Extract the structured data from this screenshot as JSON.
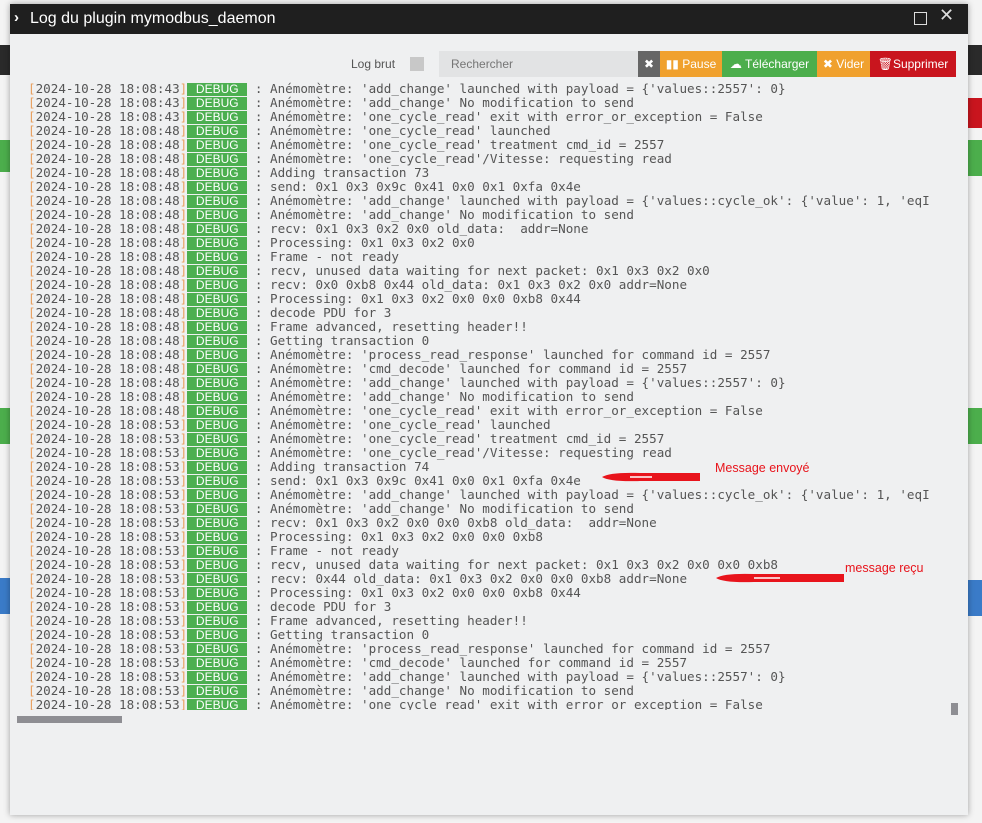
{
  "dialog": {
    "title": "Log du plugin mymodbus_daemon",
    "maximize_icon": "square-icon",
    "close_icon": "close-icon"
  },
  "toolbar": {
    "raw_log_label": "Log brut",
    "search_placeholder": "Rechercher",
    "clear_search": "✖",
    "pause_label": "Pause",
    "download_label": "Télécharger",
    "empty_label": "Vider",
    "delete_label": "Supprimer",
    "colors": {
      "pause": "#f0a12e",
      "download": "#4cae4c",
      "empty": "#f0a12e",
      "delete": "#c9151e",
      "clear": "#666666"
    }
  },
  "log_lines": [
    {
      "ts": "2024-10-28 18:08:43",
      "level": "DEBUG",
      "msg": ": Anémomètre: 'add_change' launched with payload = {'values::2557': 0}"
    },
    {
      "ts": "2024-10-28 18:08:43",
      "level": "DEBUG",
      "msg": ": Anémomètre: 'add_change' No modification to send"
    },
    {
      "ts": "2024-10-28 18:08:43",
      "level": "DEBUG",
      "msg": ": Anémomètre: 'one_cycle_read' exit with error_or_exception = False"
    },
    {
      "ts": "2024-10-28 18:08:48",
      "level": "DEBUG",
      "msg": ": Anémomètre: 'one_cycle_read' launched"
    },
    {
      "ts": "2024-10-28 18:08:48",
      "level": "DEBUG",
      "msg": ": Anémomètre: 'one_cycle_read' treatment cmd_id = 2557"
    },
    {
      "ts": "2024-10-28 18:08:48",
      "level": "DEBUG",
      "msg": ": Anémomètre: 'one_cycle_read'/Vitesse: requesting read"
    },
    {
      "ts": "2024-10-28 18:08:48",
      "level": "DEBUG",
      "msg": ": Adding transaction 73"
    },
    {
      "ts": "2024-10-28 18:08:48",
      "level": "DEBUG",
      "msg": ": send: 0x1 0x3 0x9c 0x41 0x0 0x1 0xfa 0x4e"
    },
    {
      "ts": "2024-10-28 18:08:48",
      "level": "DEBUG",
      "msg": ": Anémomètre: 'add_change' launched with payload = {'values::cycle_ok': {'value': 1, 'eqI"
    },
    {
      "ts": "2024-10-28 18:08:48",
      "level": "DEBUG",
      "msg": ": Anémomètre: 'add_change' No modification to send"
    },
    {
      "ts": "2024-10-28 18:08:48",
      "level": "DEBUG",
      "msg": ": recv: 0x1 0x3 0x2 0x0 old_data:  addr=None"
    },
    {
      "ts": "2024-10-28 18:08:48",
      "level": "DEBUG",
      "msg": ": Processing: 0x1 0x3 0x2 0x0"
    },
    {
      "ts": "2024-10-28 18:08:48",
      "level": "DEBUG",
      "msg": ": Frame - not ready"
    },
    {
      "ts": "2024-10-28 18:08:48",
      "level": "DEBUG",
      "msg": ": recv, unused data waiting for next packet: 0x1 0x3 0x2 0x0"
    },
    {
      "ts": "2024-10-28 18:08:48",
      "level": "DEBUG",
      "msg": ": recv: 0x0 0xb8 0x44 old_data: 0x1 0x3 0x2 0x0 addr=None"
    },
    {
      "ts": "2024-10-28 18:08:48",
      "level": "DEBUG",
      "msg": ": Processing: 0x1 0x3 0x2 0x0 0x0 0xb8 0x44"
    },
    {
      "ts": "2024-10-28 18:08:48",
      "level": "DEBUG",
      "msg": ": decode PDU for 3"
    },
    {
      "ts": "2024-10-28 18:08:48",
      "level": "DEBUG",
      "msg": ": Frame advanced, resetting header!!"
    },
    {
      "ts": "2024-10-28 18:08:48",
      "level": "DEBUG",
      "msg": ": Getting transaction 0"
    },
    {
      "ts": "2024-10-28 18:08:48",
      "level": "DEBUG",
      "msg": ": Anémomètre: 'process_read_response' launched for command id = 2557"
    },
    {
      "ts": "2024-10-28 18:08:48",
      "level": "DEBUG",
      "msg": ": Anémomètre: 'cmd_decode' launched for command id = 2557"
    },
    {
      "ts": "2024-10-28 18:08:48",
      "level": "DEBUG",
      "msg": ": Anémomètre: 'add_change' launched with payload = {'values::2557': 0}"
    },
    {
      "ts": "2024-10-28 18:08:48",
      "level": "DEBUG",
      "msg": ": Anémomètre: 'add_change' No modification to send"
    },
    {
      "ts": "2024-10-28 18:08:48",
      "level": "DEBUG",
      "msg": ": Anémomètre: 'one_cycle_read' exit with error_or_exception = False"
    },
    {
      "ts": "2024-10-28 18:08:53",
      "level": "DEBUG",
      "msg": ": Anémomètre: 'one_cycle_read' launched"
    },
    {
      "ts": "2024-10-28 18:08:53",
      "level": "DEBUG",
      "msg": ": Anémomètre: 'one_cycle_read' treatment cmd_id = 2557"
    },
    {
      "ts": "2024-10-28 18:08:53",
      "level": "DEBUG",
      "msg": ": Anémomètre: 'one_cycle_read'/Vitesse: requesting read"
    },
    {
      "ts": "2024-10-28 18:08:53",
      "level": "DEBUG",
      "msg": ": Adding transaction 74"
    },
    {
      "ts": "2024-10-28 18:08:53",
      "level": "DEBUG",
      "msg": ": send: 0x1 0x3 0x9c 0x41 0x0 0x1 0xfa 0x4e"
    },
    {
      "ts": "2024-10-28 18:08:53",
      "level": "DEBUG",
      "msg": ": Anémomètre: 'add_change' launched with payload = {'values::cycle_ok': {'value': 1, 'eqI"
    },
    {
      "ts": "2024-10-28 18:08:53",
      "level": "DEBUG",
      "msg": ": Anémomètre: 'add_change' No modification to send"
    },
    {
      "ts": "2024-10-28 18:08:53",
      "level": "DEBUG",
      "msg": ": recv: 0x1 0x3 0x2 0x0 0x0 0xb8 old_data:  addr=None"
    },
    {
      "ts": "2024-10-28 18:08:53",
      "level": "DEBUG",
      "msg": ": Processing: 0x1 0x3 0x2 0x0 0x0 0xb8"
    },
    {
      "ts": "2024-10-28 18:08:53",
      "level": "DEBUG",
      "msg": ": Frame - not ready"
    },
    {
      "ts": "2024-10-28 18:08:53",
      "level": "DEBUG",
      "msg": ": recv, unused data waiting for next packet: 0x1 0x3 0x2 0x0 0x0 0xb8"
    },
    {
      "ts": "2024-10-28 18:08:53",
      "level": "DEBUG",
      "msg": ": recv: 0x44 old_data: 0x1 0x3 0x2 0x0 0x0 0xb8 addr=None"
    },
    {
      "ts": "2024-10-28 18:08:53",
      "level": "DEBUG",
      "msg": ": Processing: 0x1 0x3 0x2 0x0 0x0 0xb8 0x44"
    },
    {
      "ts": "2024-10-28 18:08:53",
      "level": "DEBUG",
      "msg": ": decode PDU for 3"
    },
    {
      "ts": "2024-10-28 18:08:53",
      "level": "DEBUG",
      "msg": ": Frame advanced, resetting header!!"
    },
    {
      "ts": "2024-10-28 18:08:53",
      "level": "DEBUG",
      "msg": ": Getting transaction 0"
    },
    {
      "ts": "2024-10-28 18:08:53",
      "level": "DEBUG",
      "msg": ": Anémomètre: 'process_read_response' launched for command id = 2557"
    },
    {
      "ts": "2024-10-28 18:08:53",
      "level": "DEBUG",
      "msg": ": Anémomètre: 'cmd_decode' launched for command id = 2557"
    },
    {
      "ts": "2024-10-28 18:08:53",
      "level": "DEBUG",
      "msg": ": Anémomètre: 'add_change' launched with payload = {'values::2557': 0}"
    },
    {
      "ts": "2024-10-28 18:08:53",
      "level": "DEBUG",
      "msg": ": Anémomètre: 'add_change' No modification to send"
    },
    {
      "ts": "2024-10-28 18:08:53",
      "level": "DEBUG",
      "msg": ": Anémomètre: 'one_cycle_read' exit with error_or_exception = False"
    }
  ],
  "annotations": {
    "sent": "Message envoyé",
    "received": "message reçu",
    "color": "#e8141c"
  }
}
